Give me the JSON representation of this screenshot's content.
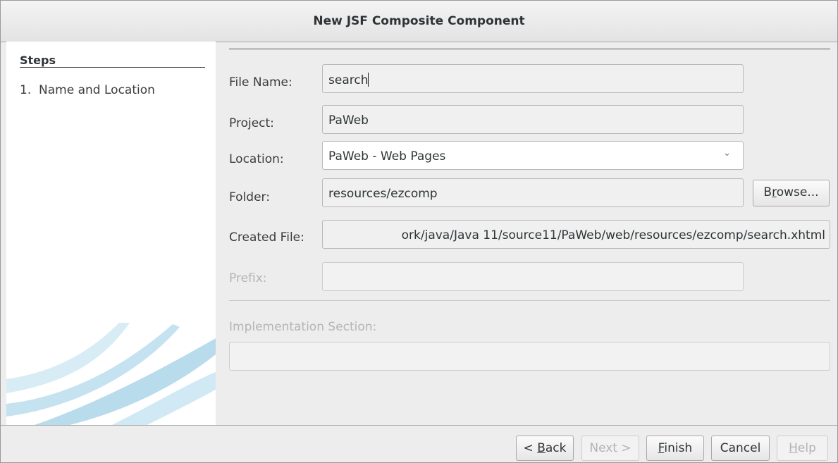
{
  "window": {
    "title": "New JSF Composite Component"
  },
  "steps": {
    "heading": "Steps",
    "items": [
      {
        "number": "1.",
        "label": "Name and Location"
      }
    ]
  },
  "form": {
    "file_name": {
      "label": "File Name:",
      "value": "search"
    },
    "project": {
      "label": "Project:",
      "value": "PaWeb"
    },
    "location": {
      "label": "Location:",
      "value": "PaWeb - Web Pages"
    },
    "folder": {
      "label": "Folder:",
      "value": "resources/ezcomp",
      "browse": {
        "pre": "B",
        "mnemonic": "r",
        "post": "owse..."
      }
    },
    "created_file": {
      "label": "Created File:",
      "value": "ork/java/Java 11/source11/PaWeb/web/resources/ezcomp/search.xhtml"
    },
    "prefix": {
      "label": "Prefix:",
      "value": ""
    },
    "implementation": {
      "label": "Implementation Section:",
      "value": ""
    }
  },
  "buttons": {
    "back": {
      "pre": "< ",
      "mnemonic": "B",
      "post": "ack"
    },
    "next": {
      "label": "Next >"
    },
    "finish": {
      "mnemonic": "F",
      "post": "inish"
    },
    "cancel": {
      "label": "Cancel"
    },
    "help": {
      "mnemonic": "H",
      "post": "elp"
    }
  },
  "colors": {
    "panel_bg": "#ffffff",
    "dialog_bg": "#ededed",
    "swoosh": "#bfe0ef"
  }
}
